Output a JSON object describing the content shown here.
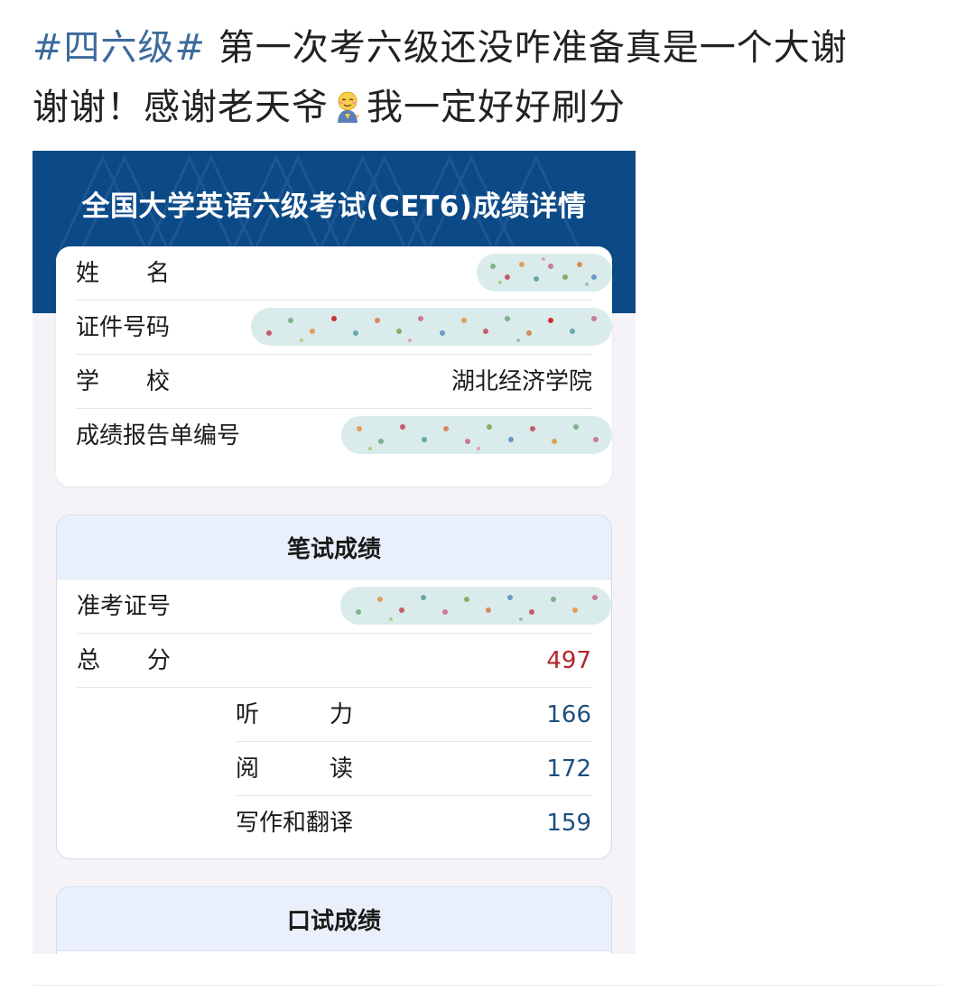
{
  "post": {
    "hashtag": "#四六级#",
    "text_line1": " 第一次考六级还没咋准备真是一个大谢",
    "text_line2_a": "谢谢！感谢老天爷",
    "text_line2_b": "我一定好好刷分",
    "emoji": "praying-emoji"
  },
  "screenshot": {
    "title": "全国大学英语六级考试(CET6)成绩详情",
    "info": {
      "name_label": "姓　　名",
      "id_label": "证件号码",
      "school_label": "学　　校",
      "school_value": "湖北经济学院",
      "report_no_label": "成绩报告单编号"
    },
    "written": {
      "heading": "笔试成绩",
      "ticket_label": "准考证号",
      "total_label": "总　　分",
      "total_value": "497",
      "listening_label": "听　　　力",
      "listening_value": "166",
      "reading_label": "阅　　　读",
      "reading_value": "172",
      "writing_label": "写作和翻译",
      "writing_value": "159"
    },
    "oral": {
      "heading": "口试成绩"
    }
  },
  "colors": {
    "hashtag": "#3d6b9c",
    "header_bg": "#0b4a86",
    "total_score": "#b3262b",
    "sub_score": "#1d4f7c",
    "redaction": "#d9eceb"
  }
}
